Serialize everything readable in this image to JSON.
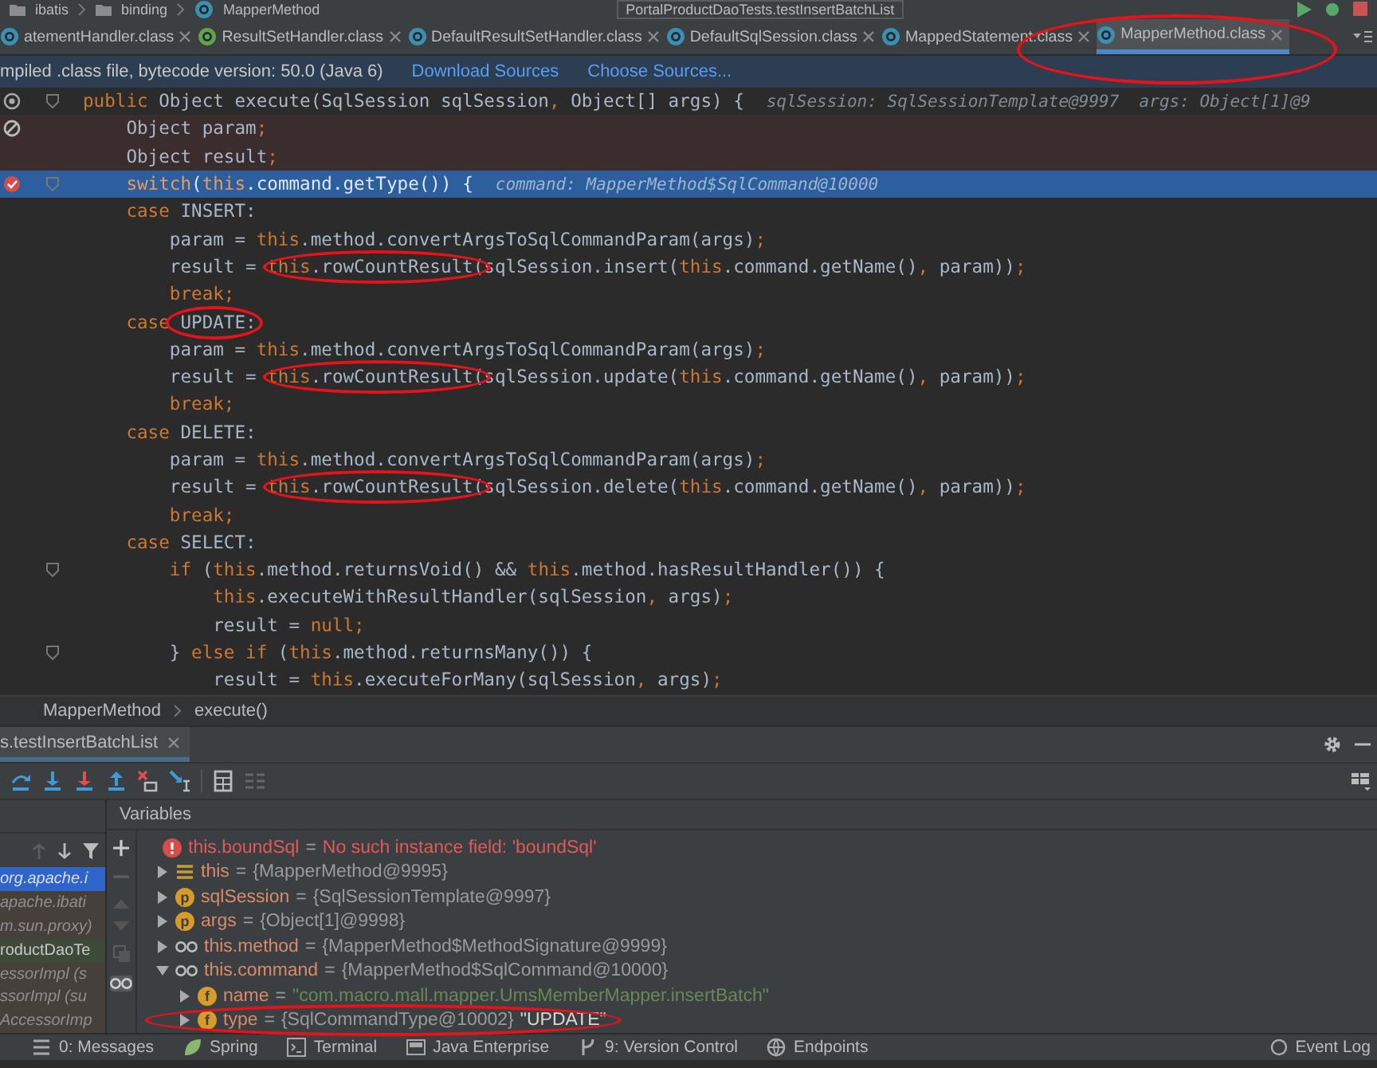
{
  "navbar": {
    "path": [
      "ibatis",
      "binding",
      "MapperMethod"
    ],
    "run_config": "PortalProductDaoTests.testInsertBatchList"
  },
  "tabs": [
    {
      "label": "atementHandler.class",
      "kind": "class",
      "selected": false,
      "circled": false
    },
    {
      "label": "ResultSetHandler.class",
      "kind": "interface",
      "selected": false,
      "circled": false
    },
    {
      "label": "DefaultResultSetHandler.class",
      "kind": "class",
      "selected": false,
      "circled": false
    },
    {
      "label": "DefaultSqlSession.class",
      "kind": "class",
      "selected": false,
      "circled": false
    },
    {
      "label": "MappedStatement.class",
      "kind": "class",
      "selected": false,
      "circled": false
    },
    {
      "label": "MapperMethod.class",
      "kind": "class",
      "selected": true,
      "circled": true
    }
  ],
  "notice": {
    "text": "mpiled .class file, bytecode version: 50.0 (Java 6)",
    "links": [
      "Download Sources",
      "Choose Sources..."
    ]
  },
  "code_lines": [
    {
      "kind": "plain",
      "override": true,
      "fold": true,
      "segments": [
        {
          "text": "public",
          "kind": "keyword"
        },
        {
          "text": " Object execute(SqlSession sqlSession",
          "kind": "plain"
        },
        {
          "text": ",",
          "kind": "keyword"
        },
        {
          "text": " Object[] args) {",
          "kind": "plain"
        },
        {
          "text": "sqlSession: SqlSessionTemplate@9997  args: Object[1]@9",
          "kind": "hint"
        }
      ]
    },
    {
      "kind": "tinted",
      "breakpoint": true,
      "muted": true,
      "fold": false,
      "segments": [
        {
          "text": "    Object param",
          "kind": "plain"
        },
        {
          "text": ";",
          "kind": "keyword"
        }
      ]
    },
    {
      "kind": "tinted",
      "fold": false,
      "segments": [
        {
          "text": "    Object result",
          "kind": "plain"
        },
        {
          "text": ";",
          "kind": "keyword"
        }
      ]
    },
    {
      "kind": "current",
      "breakpoint": true,
      "muted": false,
      "fold": true,
      "segments": [
        {
          "text": "    switch",
          "kind": "keyword"
        },
        {
          "text": "(",
          "kind": "plain"
        },
        {
          "text": "this",
          "kind": "keyword"
        },
        {
          "text": ".command.getType()) {",
          "kind": "plain"
        },
        {
          "text": "command: MapperMethod$SqlCommand@10000",
          "kind": "hint"
        }
      ]
    },
    {
      "kind": "plain",
      "fold": false,
      "segments": [
        {
          "text": "    case",
          "kind": "keyword"
        },
        {
          "text": " INSERT:",
          "kind": "plain"
        }
      ]
    },
    {
      "kind": "plain",
      "fold": false,
      "segments": [
        {
          "text": "        param = ",
          "kind": "plain"
        },
        {
          "text": "this",
          "kind": "keyword"
        },
        {
          "text": ".method.convertArgsToSqlCommandParam(args)",
          "kind": "plain"
        },
        {
          "text": ";",
          "kind": "keyword"
        }
      ]
    },
    {
      "kind": "plain",
      "fold": false,
      "segments": [
        {
          "text": "        result = ",
          "kind": "plain"
        },
        {
          "text": "this",
          "kind": "keyword",
          "circled": true
        },
        {
          "text": ".rowCountResult(",
          "kind": "plain",
          "circled": true
        },
        {
          "text": "sqlSession.insert(",
          "kind": "plain"
        },
        {
          "text": "this",
          "kind": "keyword"
        },
        {
          "text": ".command.getName()",
          "kind": "plain"
        },
        {
          "text": ",",
          "kind": "keyword"
        },
        {
          "text": " param))",
          "kind": "plain"
        },
        {
          "text": ";",
          "kind": "keyword"
        }
      ]
    },
    {
      "kind": "plain",
      "fold": false,
      "segments": [
        {
          "text": "        break;",
          "kind": "keyword"
        }
      ]
    },
    {
      "kind": "plain",
      "fold": false,
      "segments": [
        {
          "text": "    case",
          "kind": "keyword"
        },
        {
          "text": " UPDATE:",
          "kind": "plain",
          "circled": true
        }
      ]
    },
    {
      "kind": "plain",
      "fold": false,
      "segments": [
        {
          "text": "        param = ",
          "kind": "plain"
        },
        {
          "text": "this",
          "kind": "keyword"
        },
        {
          "text": ".method.convertArgsToSqlCommandParam(args)",
          "kind": "plain"
        },
        {
          "text": ";",
          "kind": "keyword"
        }
      ]
    },
    {
      "kind": "plain",
      "fold": false,
      "segments": [
        {
          "text": "        result = ",
          "kind": "plain"
        },
        {
          "text": "this",
          "kind": "keyword",
          "circled": true
        },
        {
          "text": ".rowCountResult(",
          "kind": "plain",
          "circled": true
        },
        {
          "text": "sqlSession.update(",
          "kind": "plain"
        },
        {
          "text": "this",
          "kind": "keyword"
        },
        {
          "text": ".command.getName()",
          "kind": "plain"
        },
        {
          "text": ",",
          "kind": "keyword"
        },
        {
          "text": " param))",
          "kind": "plain"
        },
        {
          "text": ";",
          "kind": "keyword"
        }
      ]
    },
    {
      "kind": "plain",
      "fold": false,
      "segments": [
        {
          "text": "        break;",
          "kind": "keyword"
        }
      ]
    },
    {
      "kind": "plain",
      "fold": false,
      "segments": [
        {
          "text": "    case",
          "kind": "keyword"
        },
        {
          "text": " DELETE:",
          "kind": "plain"
        }
      ]
    },
    {
      "kind": "plain",
      "fold": false,
      "segments": [
        {
          "text": "        param = ",
          "kind": "plain"
        },
        {
          "text": "this",
          "kind": "keyword"
        },
        {
          "text": ".method.convertArgsToSqlCommandParam(args)",
          "kind": "plain"
        },
        {
          "text": ";",
          "kind": "keyword"
        }
      ]
    },
    {
      "kind": "plain",
      "fold": false,
      "segments": [
        {
          "text": "        result = ",
          "kind": "plain"
        },
        {
          "text": "this",
          "kind": "keyword",
          "circled": true
        },
        {
          "text": ".rowCountResult(",
          "kind": "plain",
          "circled": true
        },
        {
          "text": "sqlSession.delete(",
          "kind": "plain"
        },
        {
          "text": "this",
          "kind": "keyword"
        },
        {
          "text": ".command.getName()",
          "kind": "plain"
        },
        {
          "text": ",",
          "kind": "keyword"
        },
        {
          "text": " param))",
          "kind": "plain"
        },
        {
          "text": ";",
          "kind": "keyword"
        }
      ]
    },
    {
      "kind": "plain",
      "fold": false,
      "segments": [
        {
          "text": "        break;",
          "kind": "keyword"
        }
      ]
    },
    {
      "kind": "plain",
      "fold": false,
      "segments": [
        {
          "text": "    case",
          "kind": "keyword"
        },
        {
          "text": " SELECT:",
          "kind": "plain"
        }
      ]
    },
    {
      "kind": "plain",
      "fold": true,
      "segments": [
        {
          "text": "        if",
          "kind": "keyword"
        },
        {
          "text": " (",
          "kind": "plain"
        },
        {
          "text": "this",
          "kind": "keyword"
        },
        {
          "text": ".method.returnsVoid() && ",
          "kind": "plain"
        },
        {
          "text": "this",
          "kind": "keyword"
        },
        {
          "text": ".method.hasResultHandler()) {",
          "kind": "plain"
        }
      ]
    },
    {
      "kind": "plain",
      "fold": false,
      "segments": [
        {
          "text": "            this",
          "kind": "keyword"
        },
        {
          "text": ".executeWithResultHandler(sqlSession",
          "kind": "plain"
        },
        {
          "text": ",",
          "kind": "keyword"
        },
        {
          "text": " args)",
          "kind": "plain"
        },
        {
          "text": ";",
          "kind": "keyword"
        }
      ]
    },
    {
      "kind": "plain",
      "fold": false,
      "segments": [
        {
          "text": "            result = ",
          "kind": "plain"
        },
        {
          "text": "null;",
          "kind": "keyword"
        }
      ]
    },
    {
      "kind": "plain",
      "fold": true,
      "segments": [
        {
          "text": "        } ",
          "kind": "plain"
        },
        {
          "text": "else if",
          "kind": "keyword"
        },
        {
          "text": " (",
          "kind": "plain"
        },
        {
          "text": "this",
          "kind": "keyword"
        },
        {
          "text": ".method.returnsMany()) {",
          "kind": "plain"
        }
      ]
    },
    {
      "kind": "plain",
      "fold": false,
      "segments": [
        {
          "text": "            result = ",
          "kind": "plain"
        },
        {
          "text": "this",
          "kind": "keyword"
        },
        {
          "text": ".executeForMany(sqlSession",
          "kind": "plain"
        },
        {
          "text": ",",
          "kind": "keyword"
        },
        {
          "text": " args)",
          "kind": "plain"
        },
        {
          "text": ";",
          "kind": "keyword"
        }
      ]
    }
  ],
  "breadcrumb": [
    "MapperMethod",
    "execute()"
  ],
  "debug_tab": {
    "label": "s.testInsertBatchList",
    "selected": true
  },
  "frames": [
    {
      "text": "org.apache.i",
      "kind": "library",
      "selected": true
    },
    {
      "text": "apache.ibati",
      "kind": "library",
      "selected": false
    },
    {
      "text": "m.sun.proxy)",
      "kind": "library",
      "selected": false
    },
    {
      "text": "roductDaoTe",
      "kind": "project",
      "selected": false
    },
    {
      "text": "essorImpl (s",
      "kind": "library",
      "selected": false
    },
    {
      "text": "ssorImpl (su",
      "kind": "library",
      "selected": false
    },
    {
      "text": "AccessorImp",
      "kind": "library",
      "selected": false
    }
  ],
  "variables": {
    "title": "Variables",
    "items": [
      {
        "kind": "error",
        "name": "this.boundSql",
        "assign": "=",
        "value": "No such instance field: 'boundSql'"
      },
      {
        "kind": "object",
        "name": "this",
        "assign": "=",
        "value": "{MapperMethod@9995}",
        "expanded": false
      },
      {
        "kind": "param",
        "badge": "p",
        "name": "sqlSession",
        "assign": "=",
        "value": "{SqlSessionTemplate@9997}",
        "expanded": false
      },
      {
        "kind": "param",
        "badge": "p",
        "name": "args",
        "assign": "=",
        "value": "{Object[1]@9998}",
        "expanded": false
      },
      {
        "kind": "watch",
        "name": "this.method",
        "assign": "=",
        "value": "{MapperMethod$MethodSignature@9999}",
        "expanded": false
      },
      {
        "kind": "watch",
        "name": "this.command",
        "assign": "=",
        "value": "{MapperMethod$SqlCommand@10000}",
        "expanded": true,
        "children": [
          {
            "kind": "field",
            "badge": "f",
            "name": "name",
            "assign": "=",
            "value": "\"com.macro.mall.mapper.UmsMemberMapper.insertBatch\"",
            "string_value": true,
            "expanded": false
          },
          {
            "kind": "field",
            "badge": "f",
            "name": "type",
            "assign": "=",
            "value": "{SqlCommandType@10002}",
            "label": "\"UPDATE\"",
            "circled": true,
            "expanded": false
          }
        ]
      }
    ]
  },
  "tool_windows": [
    "0: Messages",
    "Spring",
    "Terminal",
    "Java Enterprise",
    "9: Version Control",
    "Endpoints"
  ],
  "event_log": "Event Log"
}
